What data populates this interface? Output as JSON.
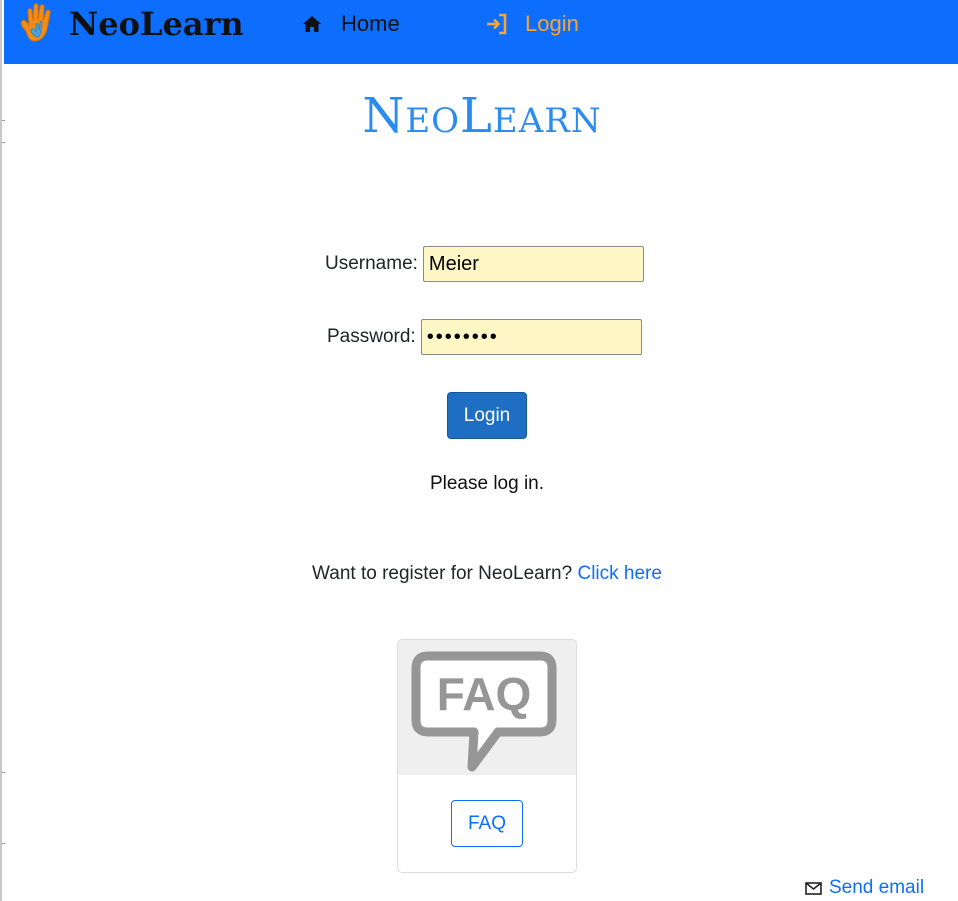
{
  "nav": {
    "brand": "NeoLearn",
    "home_label": "Home",
    "login_label": "Login"
  },
  "main": {
    "title": "NeoLearn"
  },
  "login_form": {
    "username_label": "Username:",
    "username_value": "Meier",
    "password_label": "Password:",
    "password_value": "password",
    "submit_label": "Login",
    "status": "Please log in."
  },
  "register": {
    "prompt": "Want to register for NeoLearn?",
    "link": "Click here"
  },
  "faq": {
    "image_text": "FAQ",
    "button_label": "FAQ"
  },
  "footer": {
    "send_email_label": "Send email"
  },
  "colors": {
    "navbar": "#0d6efd",
    "brand_text": "#111111",
    "login_nav": "#f6a531",
    "title": "#2a8cf0",
    "input_bg": "#fff8c6",
    "primary_button": "#1e6fc4",
    "link": "#0d6efd"
  },
  "icons": {
    "brand": "hand-logo-icon",
    "home": "home-icon",
    "login": "login-icon",
    "faq": "faq-speech-bubble-icon",
    "email": "mail-icon"
  }
}
